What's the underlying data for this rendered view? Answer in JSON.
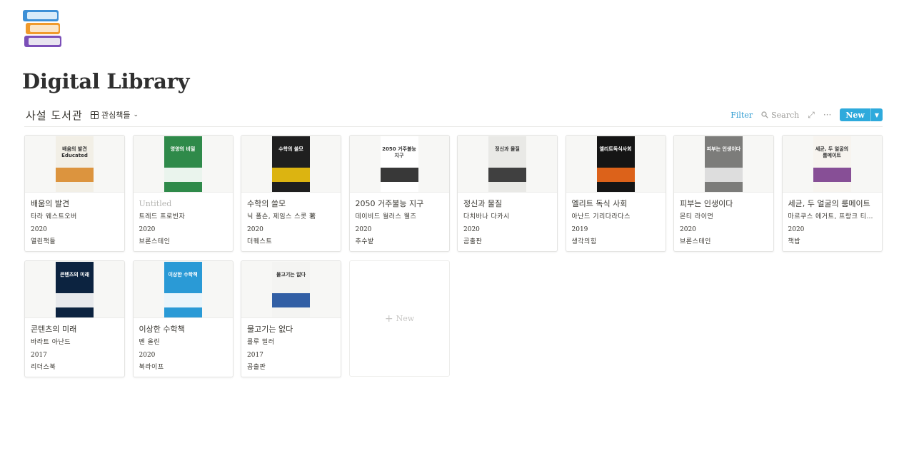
{
  "page": {
    "icon": "books-icon",
    "title": "Digital Library"
  },
  "database": {
    "title": "사설 도서관",
    "view_label": "관심책들",
    "toolbar": {
      "filter_label": "Filter",
      "search_label": "Search",
      "new_label": "New"
    },
    "new_card_label": "New"
  },
  "books": [
    {
      "title": "배움의 발견",
      "author": "타라 웨스트오버",
      "year": "2020",
      "publisher": "열린책들",
      "cover_text": "배움의 발견 Educated",
      "cover_bg": "#f2efe6",
      "cover_accent": "#d98a2b"
    },
    {
      "title": "Untitled",
      "untitled": true,
      "author": "트레드 프로빈자",
      "year": "2020",
      "publisher": "브론스테인",
      "cover_text": "영양의 비밀",
      "cover_bg": "#2f8a4a",
      "cover_accent": "#ffffff"
    },
    {
      "title": "수학의 쓸모",
      "author": "닉 폴슨, 제임스 스콧 著",
      "year": "2020",
      "publisher": "더퀘스트",
      "cover_text": "수학의 쓸모",
      "cover_bg": "#1f1f1f",
      "cover_accent": "#f1c40f"
    },
    {
      "title": "2050 거주불능 지구",
      "author": "데이비드 월러스 웰즈",
      "year": "2020",
      "publisher": "추수밭",
      "cover_text": "2050 거주불능 지구",
      "cover_bg": "#ffffff",
      "cover_accent": "#222222"
    },
    {
      "title": "정신과 물질",
      "author": "다치바나 다카시",
      "year": "2020",
      "publisher": "곰출판",
      "cover_text": "정신과 물질",
      "cover_bg": "#e9e9e6",
      "cover_accent": "#2d2d2d"
    },
    {
      "title": "엘리트 독식 사회",
      "author": "아난드 기리다라다스",
      "year": "2019",
      "publisher": "생각의힘",
      "cover_text": "엘리트독식사회",
      "cover_bg": "#151515",
      "cover_accent": "#f26a1b"
    },
    {
      "title": "피부는 인생이다",
      "author": "몬티 라이먼",
      "year": "2020",
      "publisher": "브론스테인",
      "cover_text": "피부는 인생이다",
      "cover_bg": "#7c7c7a",
      "cover_accent": "#e8e8e8"
    },
    {
      "title": "세균, 두 얼굴의 룸메이트",
      "author": "마르쿠스 에거트, 프랑크 티에수…",
      "year": "2020",
      "publisher": "책밥",
      "cover_text": "세균, 두 얼굴의 룸메이트",
      "cover_bg": "#f7f4ef",
      "cover_accent": "#7a3d8c"
    },
    {
      "title": "콘텐츠의 미래",
      "author": "바라트 아난드",
      "year": "2017",
      "publisher": "리더스북",
      "cover_text": "콘텐츠의 미래",
      "cover_bg": "#0c2340",
      "cover_accent": "#ffffff"
    },
    {
      "title": "이상한 수학책",
      "author": "벤 올린",
      "year": "2020",
      "publisher": "북라이프",
      "cover_text": "이상한 수학책",
      "cover_bg": "#2a9ad6",
      "cover_accent": "#ffffff"
    },
    {
      "title": "물고기는 없다",
      "author": "룰루 밀러",
      "year": "2017",
      "publisher": "곰출판",
      "cover_text": "물고기는 없다",
      "cover_bg": "#f4f4f2",
      "cover_accent": "#1d4f9c"
    }
  ]
}
